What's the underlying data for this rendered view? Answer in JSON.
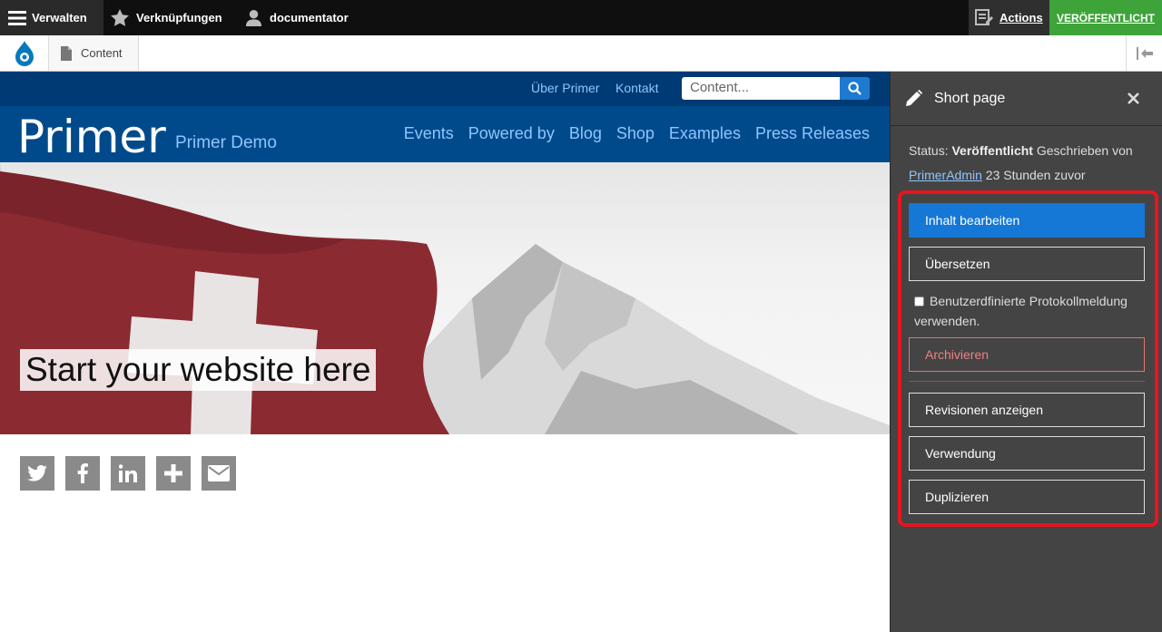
{
  "toolbar": {
    "manage_label": "Verwalten",
    "shortcuts_label": "Verknüpfungen",
    "user_label": "documentator",
    "actions_label": "Actions",
    "publish_label": "VERÖFFENTLICHT"
  },
  "tray": {
    "content_label": "Content"
  },
  "site": {
    "top_links": [
      "Über Primer",
      "Kontakt"
    ],
    "search_placeholder": "Content...",
    "name": "Primer",
    "slogan": "Primer Demo",
    "nav": [
      "Events",
      "Powered by",
      "Blog",
      "Shop",
      "Examples",
      "Press Releases"
    ],
    "hero_title": "Start your website here"
  },
  "social": [
    "twitter-icon",
    "facebook-icon",
    "linkedin-icon",
    "plus-icon",
    "envelope-icon"
  ],
  "panel": {
    "title": "Short page",
    "status_label": "Status:",
    "status_value": "Veröffentlicht",
    "written_by": "Geschrieben von",
    "author": "PrimerAdmin",
    "time_ago": "23 Stunden zuvor",
    "buttons": {
      "edit": "Inhalt bearbeiten",
      "translate": "Übersetzen",
      "custom_log": "Benutzerdfinierte Protokollmeldung verwenden.",
      "archive": "Archivieren",
      "revisions": "Revisionen anzeigen",
      "usage": "Verwendung",
      "duplicate": "Duplizieren"
    }
  },
  "colors": {
    "toolbar_bg": "#0f0f0f",
    "publish_green": "#3ea43a",
    "site_blue": "#004a8b",
    "site_top_blue": "#003a74",
    "link_blue": "#8ec5ff",
    "primary_button": "#1577d6",
    "panel_bg": "#444444",
    "highlight_red": "#e8141e"
  }
}
